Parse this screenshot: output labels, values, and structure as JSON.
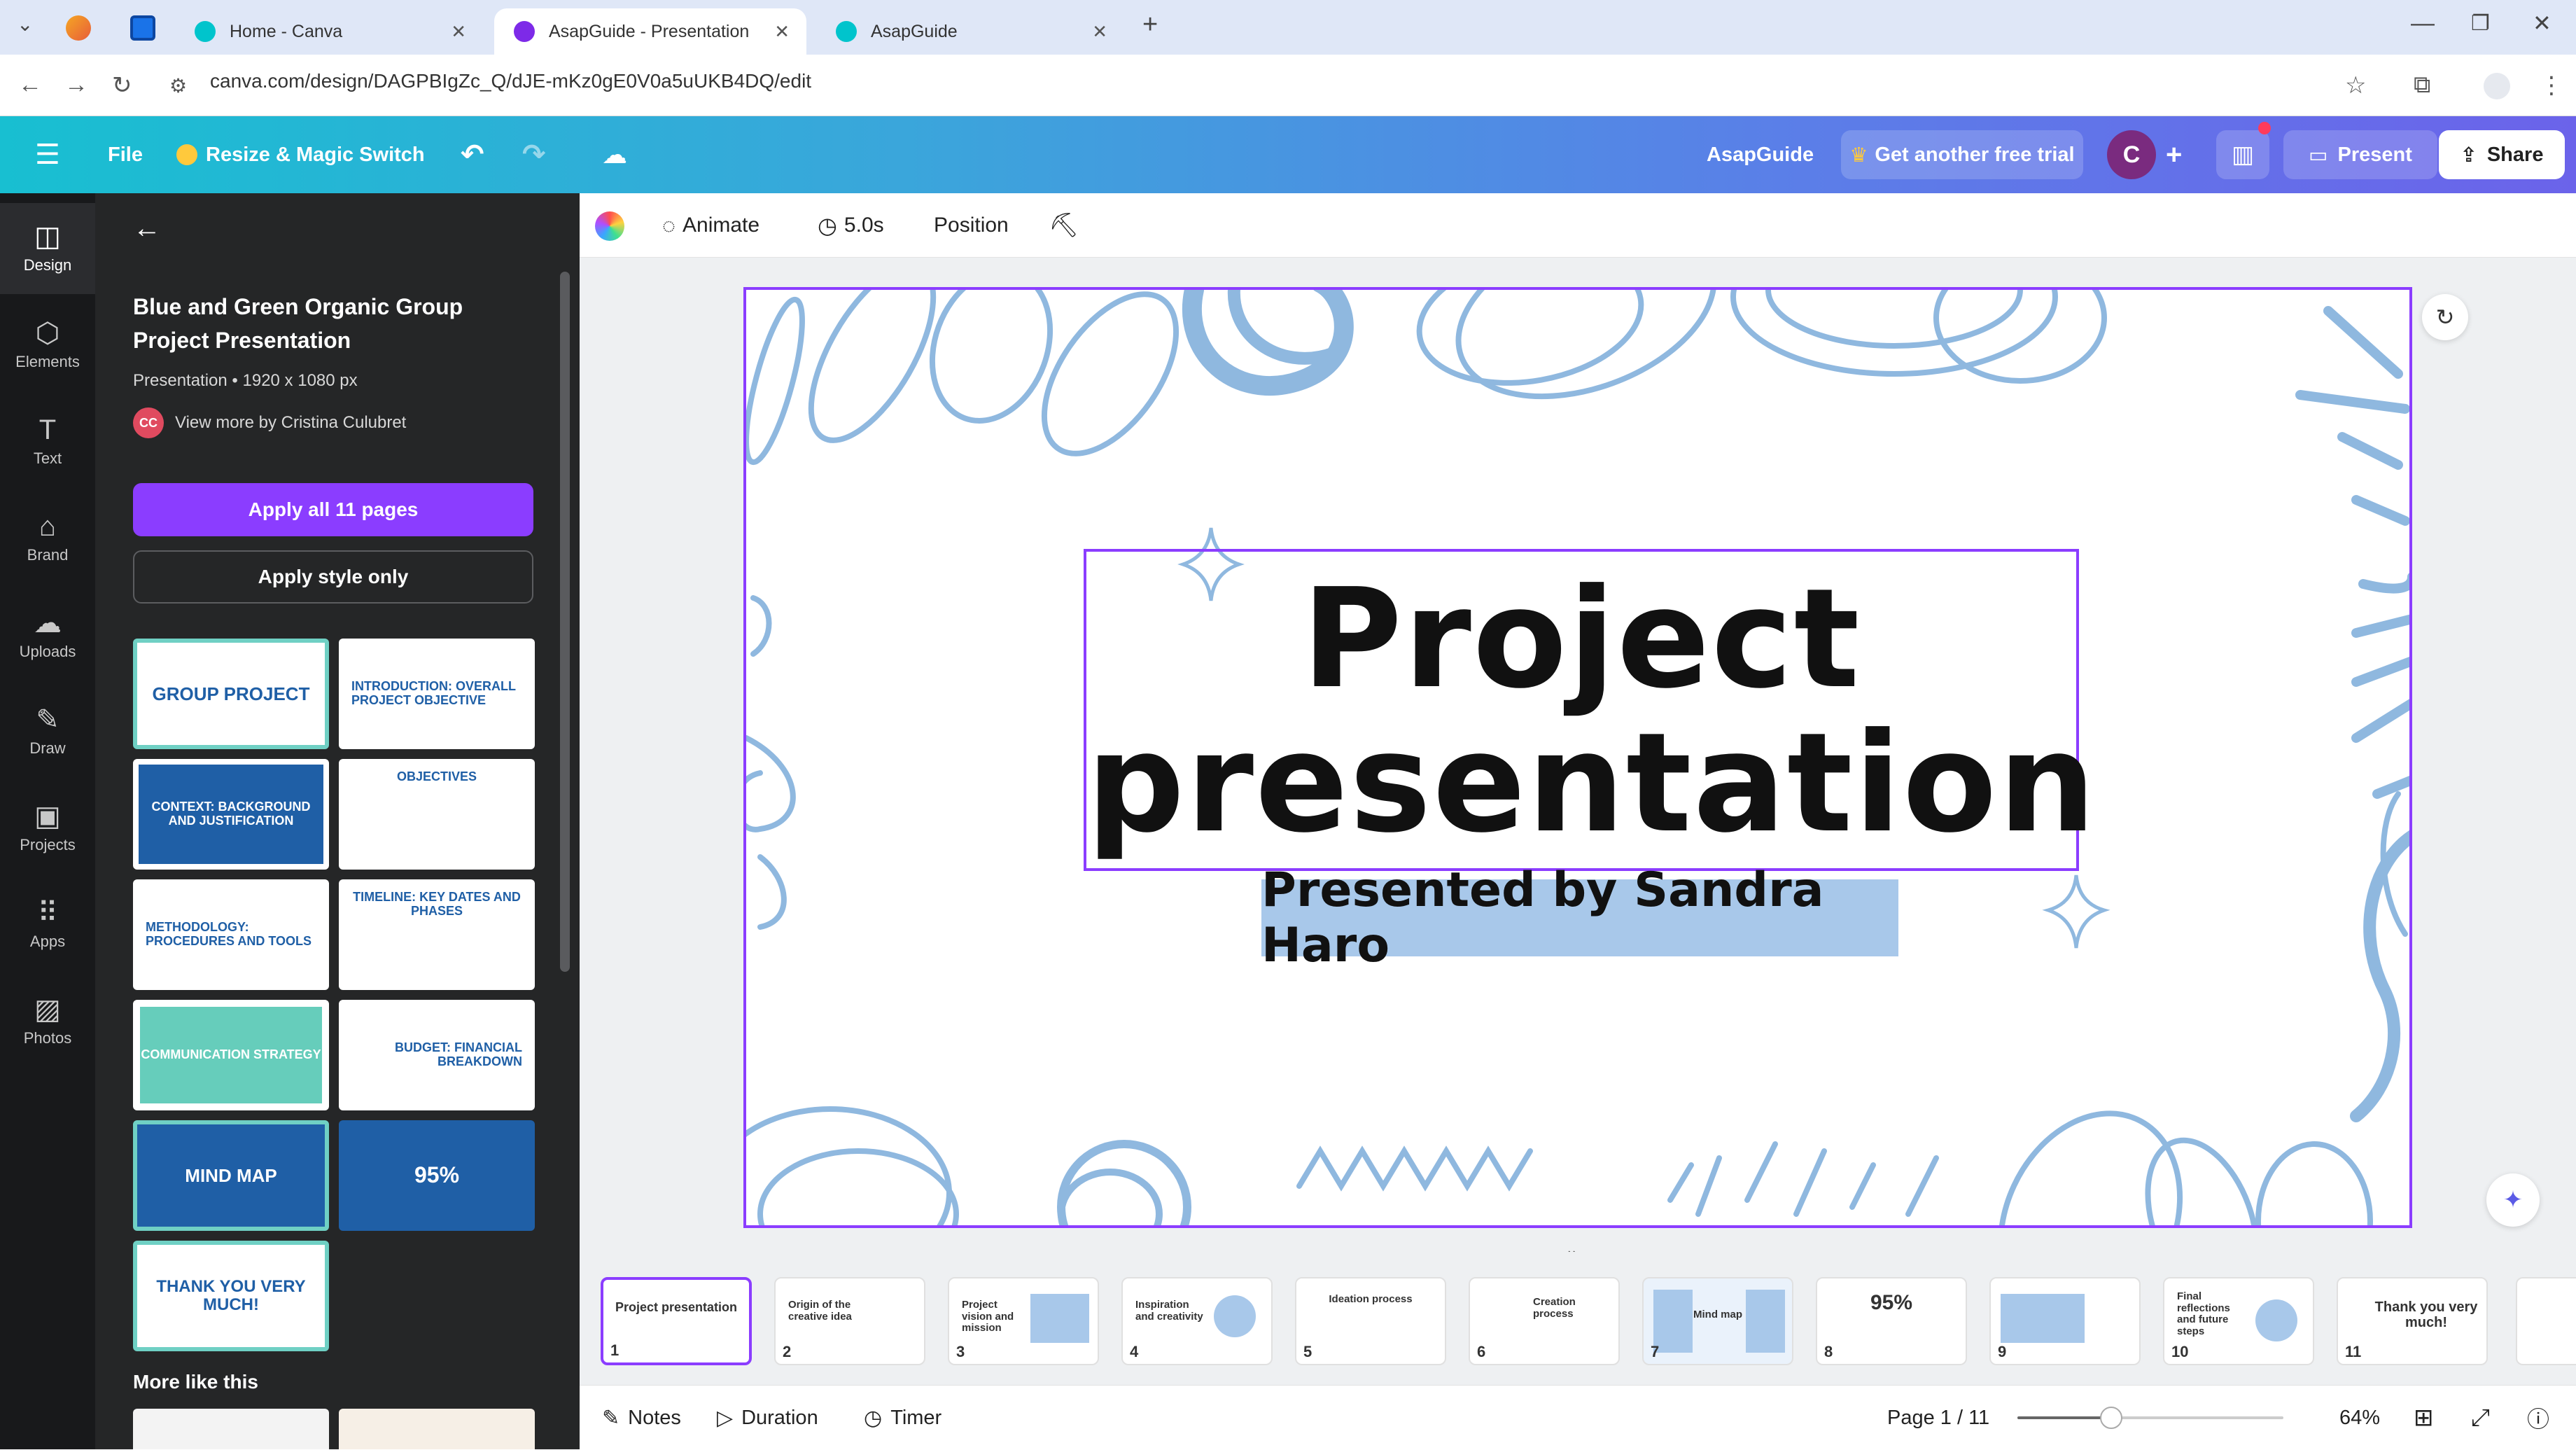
{
  "browser": {
    "tabs": [
      {
        "label": ""
      },
      {
        "label": ""
      },
      {
        "label": "Home - Canva"
      },
      {
        "label": "AsapGuide - Presentation"
      },
      {
        "label": "AsapGuide"
      }
    ],
    "url": "canva.com/design/DAGPBIgZc_Q/dJE-mKz0gE0V0a5uUKB4DQ/edit"
  },
  "header": {
    "file_label": "File",
    "resize_label": "Resize & Magic Switch",
    "project_name": "AsapGuide",
    "trial_label": "Get another free trial",
    "avatar_initial": "C",
    "present_label": "Present",
    "share_label": "Share"
  },
  "toolbar": {
    "animate_label": "Animate",
    "duration_label": "5.0s",
    "position_label": "Position"
  },
  "rail": {
    "items": [
      {
        "label": "Design"
      },
      {
        "label": "Elements"
      },
      {
        "label": "Text"
      },
      {
        "label": "Brand"
      },
      {
        "label": "Uploads"
      },
      {
        "label": "Draw"
      },
      {
        "label": "Projects"
      },
      {
        "label": "Apps"
      },
      {
        "label": "Photos"
      }
    ]
  },
  "panel": {
    "title": "Blue and Green Organic Group Project Presentation",
    "meta": "Presentation • 1920 x 1080 px",
    "author_initials": "CC",
    "author_link": "View more by Cristina Culubret",
    "apply_all_label": "Apply all 11 pages",
    "apply_style_label": "Apply style only",
    "templates": [
      {
        "text": "GROUP PROJECT"
      },
      {
        "text": "INTRODUCTION: OVERALL PROJECT OBJECTIVE"
      },
      {
        "text": "CONTEXT: BACKGROUND AND JUSTIFICATION"
      },
      {
        "text": "OBJECTIVES"
      },
      {
        "text": "METHODOLOGY: PROCEDURES AND TOOLS"
      },
      {
        "text": "TIMELINE: KEY DATES AND PHASES"
      },
      {
        "text": "COMMUNICATION STRATEGY"
      },
      {
        "text": "BUDGET: FINANCIAL BREAKDOWN"
      },
      {
        "text": "MIND MAP"
      },
      {
        "text": "95%"
      },
      {
        "text": "THANK YOU VERY MUCH!"
      }
    ],
    "more_label": "More like this"
  },
  "slide": {
    "title_line1": "Project",
    "title_line2": "presentation",
    "subtitle": "Presented by Sandra Haro"
  },
  "filmstrip": {
    "pages": [
      {
        "num": "1",
        "title": "Project presentation"
      },
      {
        "num": "2",
        "title": "Origin of the creative idea"
      },
      {
        "num": "3",
        "title": "Project vision and mission"
      },
      {
        "num": "4",
        "title": "Inspiration and creativity"
      },
      {
        "num": "5",
        "title": "Ideation process"
      },
      {
        "num": "6",
        "title": "Creation process"
      },
      {
        "num": "7",
        "title": "Mind map"
      },
      {
        "num": "8",
        "title": "95%"
      },
      {
        "num": "9",
        "title": ""
      },
      {
        "num": "10",
        "title": "Final reflections and future steps"
      },
      {
        "num": "11",
        "title": "Thank you very much!"
      }
    ]
  },
  "footer": {
    "notes_label": "Notes",
    "duration_label": "Duration",
    "timer_label": "Timer",
    "page_indicator": "Page 1 / 11",
    "zoom": 64,
    "zoom_label": "64%"
  },
  "colors": {
    "accent": "#8b3dff",
    "slide_doodle": "#8fb8df",
    "subtitle_highlight": "#a8c8ea"
  }
}
